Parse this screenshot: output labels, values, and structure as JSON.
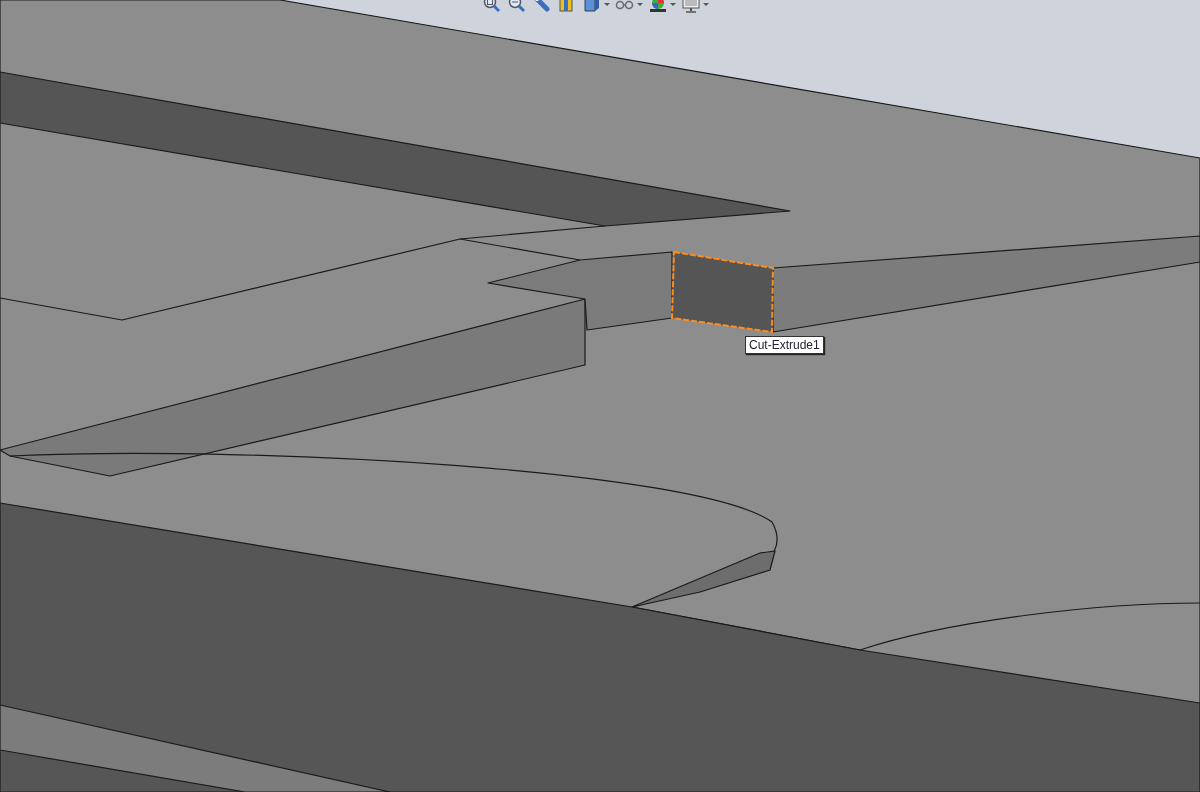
{
  "toolbar": {
    "buttons": [
      {
        "kind": "zoom-fit",
        "dropdown": false
      },
      {
        "kind": "zoom-area",
        "dropdown": false
      },
      {
        "kind": "previous-view",
        "dropdown": false
      },
      {
        "kind": "section-view",
        "dropdown": false
      },
      {
        "kind": "view-orientation",
        "dropdown": true
      },
      {
        "kind": "hide-show",
        "dropdown": true
      },
      {
        "kind": "appearance",
        "dropdown": true
      },
      {
        "kind": "scene",
        "dropdown": true
      }
    ]
  },
  "selected_feature": {
    "label": "Cut-Extrude1",
    "highlighted": true
  }
}
